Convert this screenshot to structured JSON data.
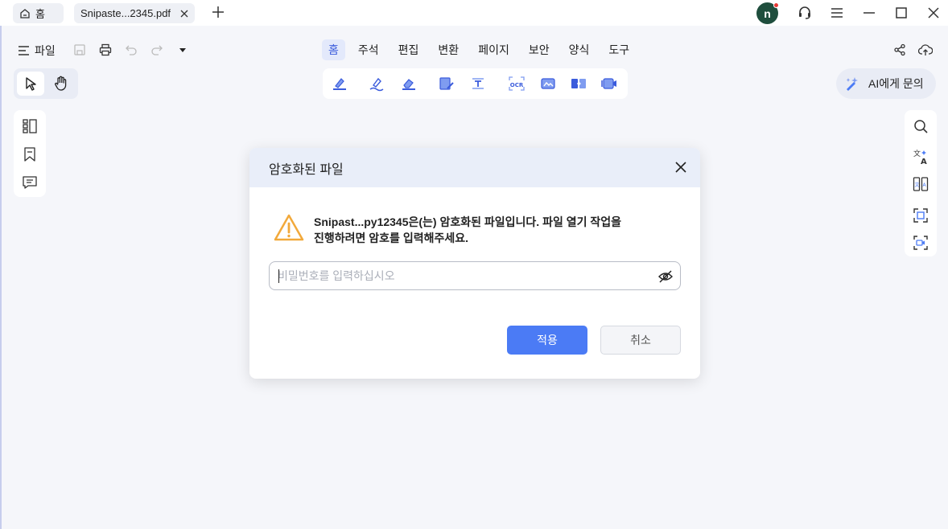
{
  "tabs": {
    "home_label": "홈",
    "document_label": "Snipaste...2345.pdf"
  },
  "user": {
    "avatar_initial": "n"
  },
  "menu": {
    "file_label": "파일",
    "main_tabs": [
      "홈",
      "주석",
      "편집",
      "변환",
      "페이지",
      "보안",
      "양식",
      "도구"
    ],
    "active_tab": "홈"
  },
  "ai": {
    "label": "AI에게 문의"
  },
  "dialog": {
    "title": "암호화된 파일",
    "message_line1": "Snipast...py12345은(는) 암호화된 파일입니다. 파일 열기 작업을",
    "message_line2": "진행하려면 암호를 입력해주세요.",
    "password_placeholder": "비밀번호를 입력하십시오",
    "password_value": "",
    "apply_label": "적용",
    "cancel_label": "취소"
  },
  "colors": {
    "accent": "#4b7bf5",
    "active_tab_bg": "#e3e9fb",
    "warning": "#f2a93b",
    "avatar_bg": "#1f4e3d",
    "notification_dot": "#e53935"
  },
  "icons": {
    "titlebar": [
      "home-icon",
      "close-icon",
      "plus-icon",
      "headset-icon",
      "hamburger-icon",
      "minimize-icon",
      "maximize-icon",
      "window-close-icon"
    ],
    "menubar": [
      "menu-icon",
      "save-icon",
      "print-icon",
      "undo-icon",
      "redo-icon",
      "dropdown-icon",
      "share-icon",
      "cloud-upload-icon"
    ],
    "toolstrip": [
      "highlight-icon",
      "underline-icon",
      "eraser-icon",
      "edit-text-icon",
      "text-box-icon",
      "ocr-icon",
      "image-icon",
      "convert-icon",
      "screen-record-icon"
    ],
    "left_panel": [
      "thumbnails-icon",
      "bookmark-icon",
      "comment-icon"
    ],
    "right_panel": [
      "search-icon",
      "translate-icon",
      "compare-icon",
      "screenshot-icon",
      "record-icon"
    ]
  }
}
